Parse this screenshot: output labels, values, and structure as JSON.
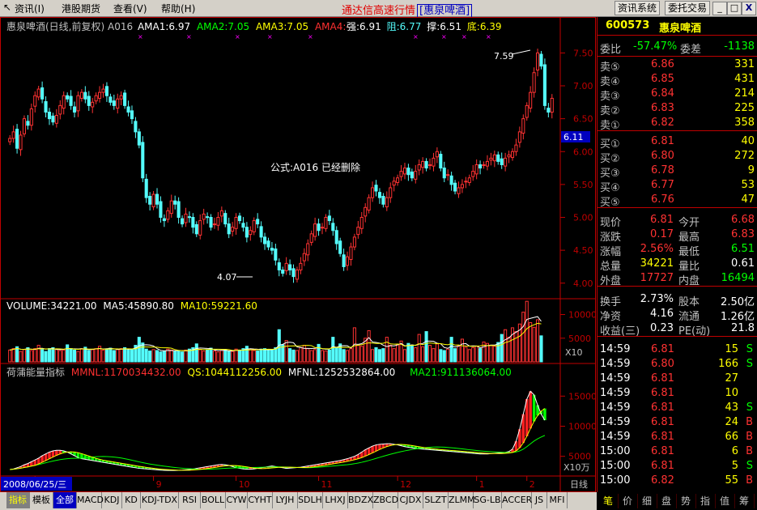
{
  "menu": {
    "items": [
      "资讯(I)",
      "港股期货",
      "查看(V)",
      "帮助(H)"
    ],
    "title": "通达信高速行情",
    "stock_bracket": "[惠泉啤酒]",
    "btn_info": "资讯系统",
    "btn_trade": "委托交易",
    "win_min": "_",
    "win_max": "□",
    "win_close": "X"
  },
  "kline": {
    "header_name": "惠泉啤酒(日线,前复权) A016",
    "ama1": "AMA1:6.97",
    "ama2": "AMA2:7.05",
    "ama3": "AMA3:7.05",
    "ama4": "AMA4:-",
    "qiang": "强:6.91",
    "zu": "阻:6.77",
    "cheng": "撑:6.51",
    "di": "底:6.39",
    "ama1_color": "#ffffff",
    "ama2_color": "#00ff00",
    "ama3_color": "#ffff00",
    "ama4_color": "#ff3030",
    "notice": "公式:A016 已经删除",
    "high_label": "7.59",
    "low_label": "4.07",
    "current_price_tag": "6.11",
    "y_ticks": [
      "7.50",
      "7.00",
      "6.50",
      "6.00",
      "5.50",
      "5.00",
      "4.50",
      "4.00"
    ],
    "up_color": "#ff3232",
    "down_color": "#54fcfc"
  },
  "volume": {
    "header": "VOLUME:34221.00",
    "ma5": "MA5:45890.80",
    "ma10": "MA10:59221.60",
    "y_ticks": [
      "10000",
      "5000"
    ],
    "unit": "X10"
  },
  "energy": {
    "header": "荷蒲能量指标",
    "mmnl": "MMNL:1170034432.00",
    "qs": "QS:1044112256.00",
    "mfnl": "MFNL:1252532864.00",
    "ma21": "MA21:911136064.00",
    "y_ticks": [
      "15000",
      "10000",
      "5000"
    ],
    "unit": "X10万"
  },
  "xaxis": {
    "date": "2008/06/25/三",
    "months": [
      "8",
      "9",
      "10",
      "11",
      "12",
      "1",
      "2"
    ],
    "period": "日线"
  },
  "bottom_tabs": [
    "指标",
    "模板",
    "全部",
    "MACD",
    "KDJ",
    "KD",
    "KDJ-TDX",
    "RSI",
    "BOLL",
    "CYW",
    "CYHT",
    "LYJH",
    "SDLH",
    "LHXJ",
    "BDZX",
    "ZBCD",
    "CJDX",
    "SLZT",
    "ZLMM",
    "SG-LB",
    "ACCER",
    "JS",
    "MFI"
  ],
  "quote": {
    "code": "600573",
    "name": "惠泉啤酒",
    "weibi_label": "委比",
    "weibi": "-57.47%",
    "weicha_label": "委差",
    "weicha": "-1138",
    "sells": [
      {
        "label": "卖⑤",
        "price": "6.86",
        "vol": "331"
      },
      {
        "label": "卖④",
        "price": "6.85",
        "vol": "431"
      },
      {
        "label": "卖③",
        "price": "6.84",
        "vol": "214"
      },
      {
        "label": "卖②",
        "price": "6.83",
        "vol": "225"
      },
      {
        "label": "卖①",
        "price": "6.82",
        "vol": "358"
      }
    ],
    "buys": [
      {
        "label": "买①",
        "price": "6.81",
        "vol": "40"
      },
      {
        "label": "买②",
        "price": "6.80",
        "vol": "272"
      },
      {
        "label": "买③",
        "price": "6.78",
        "vol": "9"
      },
      {
        "label": "买④",
        "price": "6.77",
        "vol": "53"
      },
      {
        "label": "买⑤",
        "price": "6.76",
        "vol": "47"
      }
    ],
    "stats": [
      {
        "l1": "现价",
        "v1": "6.81",
        "c1": "#ff3232",
        "l2": "今开",
        "v2": "6.68",
        "c2": "#ff3232"
      },
      {
        "l1": "涨跌",
        "v1": "0.17",
        "c1": "#ff3232",
        "l2": "最高",
        "v2": "6.83",
        "c2": "#ff3232"
      },
      {
        "l1": "涨幅",
        "v1": "2.56%",
        "c1": "#ff3232",
        "l2": "最低",
        "v2": "6.51",
        "c2": "#00ff00"
      },
      {
        "l1": "总量",
        "v1": "34221",
        "c1": "#ffff00",
        "l2": "量比",
        "v2": "0.61",
        "c2": "#ffffff"
      },
      {
        "l1": "外盘",
        "v1": "17727",
        "c1": "#ff3232",
        "l2": "内盘",
        "v2": "16494",
        "c2": "#00ff00"
      }
    ],
    "stats2": [
      {
        "l1": "换手",
        "v1": "2.73%",
        "l2": "股本",
        "v2": "2.50亿"
      },
      {
        "l1": "净资",
        "v1": "4.16",
        "l2": "流通",
        "v2": "1.26亿"
      },
      {
        "l1": "收益(三)",
        "v1": "0.23",
        "l2": "PE(动)",
        "v2": "21.8"
      }
    ],
    "ticks": [
      {
        "time": "14:59",
        "price": "6.81",
        "vol": "15",
        "flag": "S"
      },
      {
        "time": "14:59",
        "price": "6.80",
        "vol": "166",
        "flag": "S"
      },
      {
        "time": "14:59",
        "price": "6.81",
        "vol": "27",
        "flag": ""
      },
      {
        "time": "14:59",
        "price": "6.81",
        "vol": "10",
        "flag": ""
      },
      {
        "time": "14:59",
        "price": "6.81",
        "vol": "43",
        "flag": "S"
      },
      {
        "time": "14:59",
        "price": "6.81",
        "vol": "24",
        "flag": "B"
      },
      {
        "time": "14:59",
        "price": "6.81",
        "vol": "66",
        "flag": "B"
      },
      {
        "time": "15:00",
        "price": "6.81",
        "vol": "6",
        "flag": "B"
      },
      {
        "time": "15:00",
        "price": "6.81",
        "vol": "5",
        "flag": "S"
      },
      {
        "time": "15:00",
        "price": "6.82",
        "vol": "55",
        "flag": "B"
      }
    ],
    "right_tabs": [
      "笔",
      "价",
      "细",
      "盘",
      "势",
      "指",
      "值",
      "筹"
    ]
  },
  "chart_data": [
    {
      "type": "candlestick",
      "title": "惠泉啤酒(日线,前复权) A016",
      "ylim": [
        3.8,
        7.8
      ],
      "y_ticks": [
        7.5,
        7.0,
        6.5,
        6.0,
        5.5,
        5.0,
        4.5,
        4.0
      ],
      "x_months": [
        "8",
        "9",
        "10",
        "11",
        "12",
        "1",
        "2"
      ],
      "close": [
        6.2,
        6.3,
        6.05,
        6.25,
        6.5,
        6.4,
        6.65,
        6.85,
        6.95,
        6.8,
        6.6,
        6.5,
        6.45,
        6.55,
        6.7,
        6.85,
        6.8,
        6.7,
        6.6,
        6.85,
        6.9,
        6.8,
        6.7,
        6.75,
        6.85,
        6.9,
        6.95,
        6.85,
        6.75,
        6.7,
        6.8,
        6.85,
        6.7,
        6.6,
        6.5,
        6.3,
        6.1,
        5.6,
        5.3,
        5.2,
        5.35,
        5.2,
        5.0,
        4.95,
        5.1,
        5.25,
        5.2,
        5.0,
        4.9,
        5.05,
        5.0,
        4.85,
        4.75,
        4.95,
        5.05,
        5.0,
        4.85,
        4.9,
        5.0,
        5.1,
        4.9,
        4.75,
        4.85,
        5.0,
        4.95,
        4.85,
        4.7,
        4.8,
        4.95,
        4.9,
        4.7,
        4.6,
        4.55,
        4.5,
        4.35,
        4.2,
        4.15,
        4.3,
        4.2,
        4.1,
        4.2,
        4.3,
        4.45,
        4.6,
        4.75,
        4.9,
        4.8,
        4.85,
        5.0,
        4.95,
        4.8,
        4.6,
        4.45,
        4.25,
        4.4,
        4.55,
        4.7,
        4.85,
        5.0,
        5.15,
        5.3,
        5.45,
        5.4,
        5.3,
        5.2,
        5.3,
        5.45,
        5.55,
        5.6,
        5.7,
        5.75,
        5.65,
        5.6,
        5.7,
        5.8,
        5.85,
        5.75,
        5.8,
        5.9,
        6.0,
        5.75,
        5.6,
        5.65,
        5.5,
        5.4,
        5.45,
        5.5,
        5.55,
        5.6,
        5.7,
        5.8,
        5.75,
        5.8,
        5.85,
        5.9,
        5.95,
        5.85,
        5.8,
        5.9,
        5.95,
        6.0,
        6.1,
        6.3,
        6.5,
        6.7,
        6.9,
        7.2,
        7.5,
        7.3,
        6.7,
        6.6,
        6.81
      ]
    },
    {
      "type": "bar",
      "title": "VOLUME:34221.00",
      "ylim": [
        0,
        13000
      ],
      "y_ticks": [
        10000,
        5000
      ],
      "series": [
        {
          "name": "MA5",
          "value": 45890.8
        },
        {
          "name": "MA10",
          "value": 59221.6
        }
      ],
      "values": [
        2500,
        2800,
        3200,
        2200,
        2600,
        3000,
        2400,
        2800,
        3500,
        2600,
        2200,
        2800,
        3000,
        2600,
        2400,
        2500,
        3600,
        2800,
        2500,
        2200,
        2800,
        3100,
        2400,
        2600,
        2800,
        3300,
        2500,
        2700,
        2900,
        2400,
        2600,
        2800,
        3000,
        2500,
        2700,
        3500,
        5200,
        4000,
        2700,
        2300,
        2600,
        2400,
        2100,
        2300,
        2700,
        2500,
        2200,
        2400,
        2100,
        2500,
        2700,
        3000,
        3800,
        2600,
        2300,
        2500,
        2900,
        2300,
        2100,
        2400,
        2600,
        2300,
        2200,
        2700,
        2500,
        2800,
        3300,
        2600,
        2400,
        2300,
        2700,
        2800,
        2600,
        2500,
        3000,
        6800,
        3600,
        4500,
        2800,
        2500,
        2400,
        3000,
        3500,
        2800,
        2400,
        2600,
        3700,
        2400,
        2300,
        2500,
        5200,
        3000,
        3800,
        2600,
        2400,
        2800,
        7200,
        3500,
        3300,
        5000,
        6600,
        2600,
        3000,
        2600,
        2800,
        5200,
        3500,
        2800,
        3600,
        4400,
        2600,
        3900,
        3500,
        3000,
        5800,
        3200,
        6400,
        3500,
        2800,
        3800,
        2600,
        2400,
        2700,
        5200,
        2800,
        3400,
        4800,
        3100,
        2600,
        3000,
        3300,
        2800,
        4200,
        3900,
        3500,
        3300,
        4100,
        5800,
        6800,
        5200,
        7200,
        6400,
        8000,
        10500,
        12800,
        8300,
        7300,
        8900,
        5500
      ]
    },
    {
      "type": "area",
      "title": "荷蒲能量指标",
      "ylim": [
        2000,
        18000
      ],
      "y_ticks": [
        15000,
        10000,
        5000
      ],
      "series": [
        {
          "name": "MMNL",
          "value": 1170034432.0
        },
        {
          "name": "QS",
          "value": 1044112256.0
        },
        {
          "name": "MFNL",
          "value": 1252532864.0
        },
        {
          "name": "MA21",
          "value": 911136064.0
        }
      ],
      "mmnl": [
        2800,
        2900,
        3100,
        3300,
        3600,
        3800,
        4100,
        4400,
        4700,
        5100,
        5400,
        5700,
        5900,
        6000,
        6000,
        5900,
        5700,
        5400,
        5100,
        4800,
        4600,
        4500,
        4400,
        4300,
        4200,
        4100,
        4000,
        3900,
        3800,
        3700,
        3600,
        3500,
        3400,
        3300,
        3200,
        3100,
        3000,
        2950,
        2900,
        2850,
        2800,
        2750,
        2700,
        2680,
        2660,
        2650,
        2650,
        2680,
        2700,
        2750,
        2800,
        2900,
        3000,
        3100,
        3200,
        3300,
        3400,
        3500,
        3600,
        3650,
        3600,
        3500,
        3300,
        3100,
        3000,
        2900,
        2850,
        2850,
        2900,
        3000,
        3100,
        3200,
        3300,
        3400,
        3300,
        3200,
        3100,
        3000,
        3050,
        3100,
        3150,
        3200,
        3300,
        3400,
        3500,
        3600,
        3700,
        3800,
        3900,
        4000,
        4100,
        4200,
        4300,
        4450,
        4600,
        4800,
        5000,
        5300,
        5700,
        6100,
        6400,
        6700,
        6900,
        7000,
        7050,
        7100,
        7100,
        7000,
        6900,
        6750,
        6600,
        6500,
        6400,
        6300,
        6250,
        6200,
        6150,
        6100,
        6050,
        6000,
        5950,
        5900,
        5850,
        5800,
        5750,
        5700,
        5650,
        5600,
        5550,
        5500,
        5450,
        5400,
        5400,
        5400,
        5450,
        5500,
        5550,
        5600,
        5650,
        5800,
        6200,
        7500,
        9500,
        12000,
        14500,
        15800,
        15200,
        13500,
        12000,
        11000
      ]
    }
  ]
}
